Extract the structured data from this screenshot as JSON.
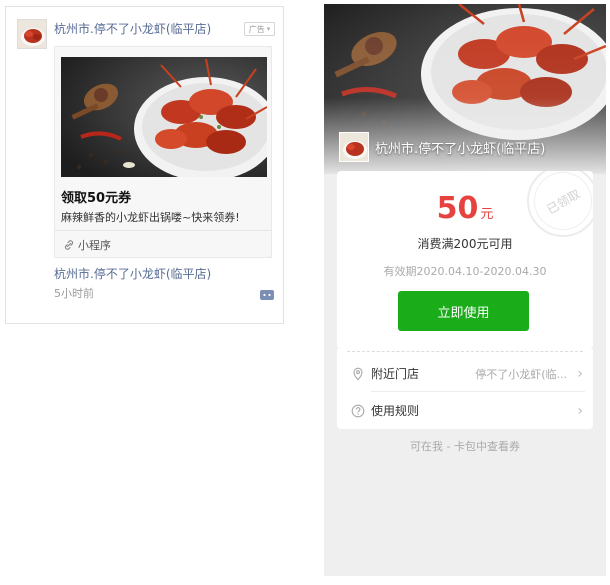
{
  "feed": {
    "advertiser_name": "杭州市.停不了小龙虾(临平店)",
    "ad_tag": "广告",
    "ad_title": "领取50元券",
    "ad_description": "麻辣鲜香的小龙虾出锅喽~快来领券!",
    "mini_program_label": "小程序",
    "shop_name": "杭州市.停不了小龙虾(临平店)",
    "posted_time": "5小时前"
  },
  "coupon_page": {
    "merchant_name": "杭州市.停不了小龙虾(临平店)",
    "amount": "50",
    "amount_unit": "元",
    "condition": "消费满200元可用",
    "validity": "有效期2020.04.10-2020.04.30",
    "use_button": "立即使用",
    "stamp_text": "已领取",
    "nearby_store_label": "附近门店",
    "nearby_store_value": "停不了小龙虾(临...",
    "usage_rules_label": "使用规则",
    "footer_text": "可在我 - 卡包中查看券"
  },
  "colors": {
    "link_blue": "#576b95",
    "coupon_red": "#e64340",
    "button_green": "#1aad19",
    "page_gray": "#efefef"
  },
  "icons": [
    "ad-tag-chevron-icon",
    "mini-program-link-icon",
    "comment-icon",
    "location-pin-icon",
    "help-circle-icon",
    "chevron-right-icon"
  ]
}
